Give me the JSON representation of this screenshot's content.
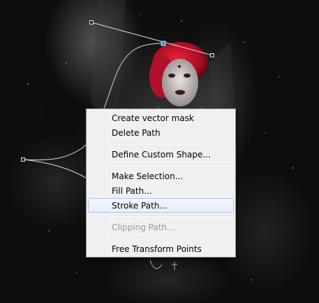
{
  "context_menu": {
    "groups": [
      [
        {
          "label": "Create vector mask",
          "enabled": true
        },
        {
          "label": "Delete Path",
          "enabled": true
        }
      ],
      [
        {
          "label": "Define Custom Shape...",
          "enabled": true
        }
      ],
      [
        {
          "label": "Make Selection...",
          "enabled": true
        },
        {
          "label": "Fill Path...",
          "enabled": true
        },
        {
          "label": "Stroke Path...",
          "enabled": true,
          "highlighted": true
        }
      ],
      [
        {
          "label": "Clipping Path...",
          "enabled": false
        }
      ],
      [
        {
          "label": "Free Transform Points",
          "enabled": true
        }
      ]
    ]
  },
  "colors": {
    "menu_background": "#f0f0f0",
    "highlight_border": "#a8c6ee",
    "disabled_text": "#9a9a9a",
    "hair": "#c0102a",
    "anchor_point_selected": "#3a9bd8",
    "path_line": "#d8d8d8"
  }
}
